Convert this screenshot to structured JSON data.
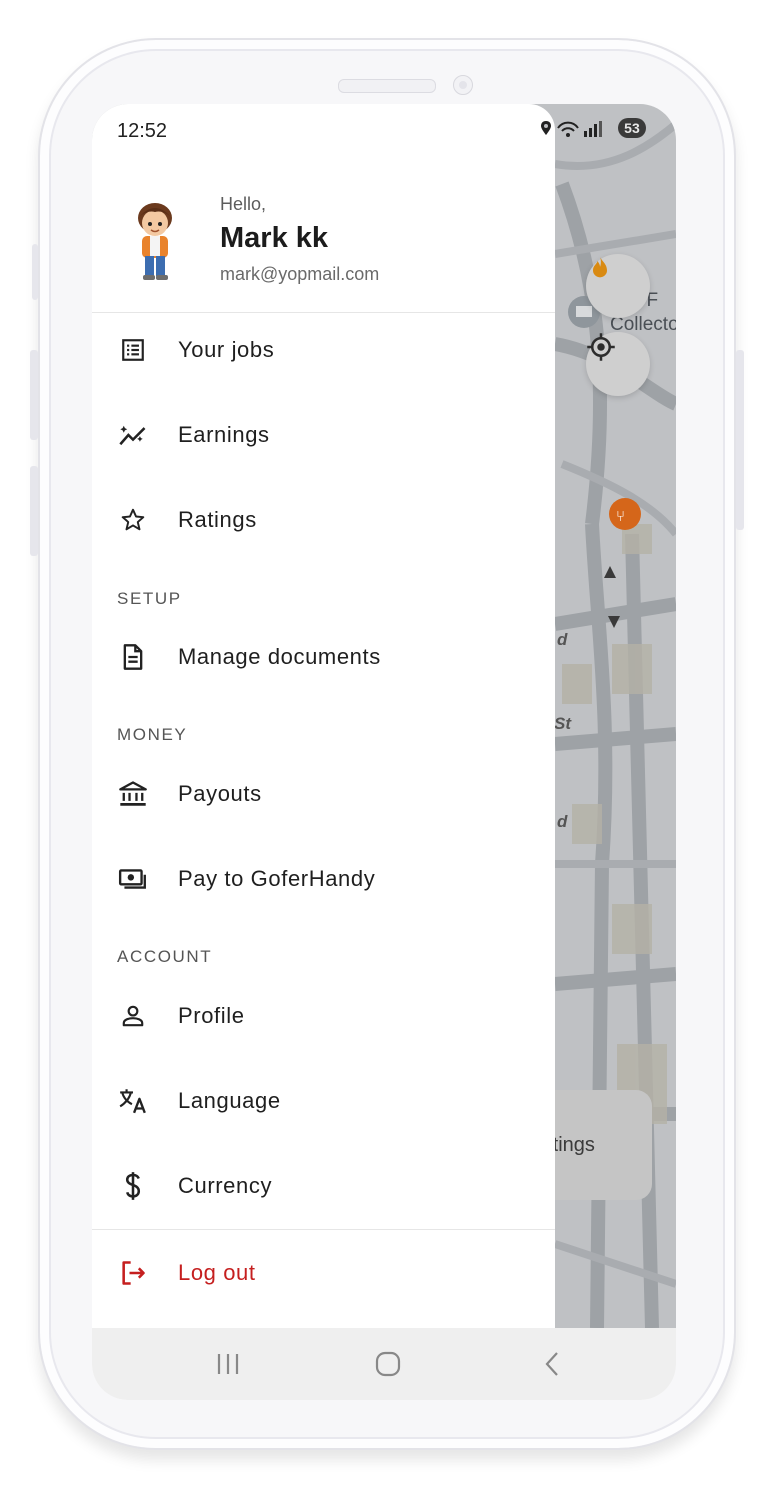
{
  "status_bar": {
    "time": "12:52",
    "battery": "53"
  },
  "user": {
    "greeting": "Hello,",
    "name": "Mark kk",
    "email": "mark@yopmail.com"
  },
  "menu": {
    "your_jobs": "Your jobs",
    "earnings": "Earnings",
    "ratings": "Ratings",
    "setup_header": "SETUP",
    "manage_documents": "Manage documents",
    "money_header": "MONEY",
    "payouts": "Payouts",
    "pay_to_goferhandy": "Pay to GoferHandy",
    "account_header": "ACCOUNT",
    "profile": "Profile",
    "language": "Language",
    "currency": "Currency",
    "logout": "Log out"
  },
  "map": {
    "card_text": "ettings",
    "poi_text_1": "OUF",
    "poi_text_2": "Collecto",
    "street_1": "d",
    "street_2": "St",
    "street_3": "d"
  },
  "icons": {
    "your_jobs": "list-icon",
    "earnings": "trending-up-icon",
    "ratings": "star-icon",
    "manage_documents": "document-icon",
    "payouts": "bank-icon",
    "pay_to_goferhandy": "payments-icon",
    "profile": "person-icon",
    "language": "translate-icon",
    "currency": "dollar-icon",
    "logout": "logout-icon"
  },
  "colors": {
    "logout": "#c51f1f",
    "map_overlay": "#bfc1c4",
    "poi_orange": "#d5661a"
  }
}
